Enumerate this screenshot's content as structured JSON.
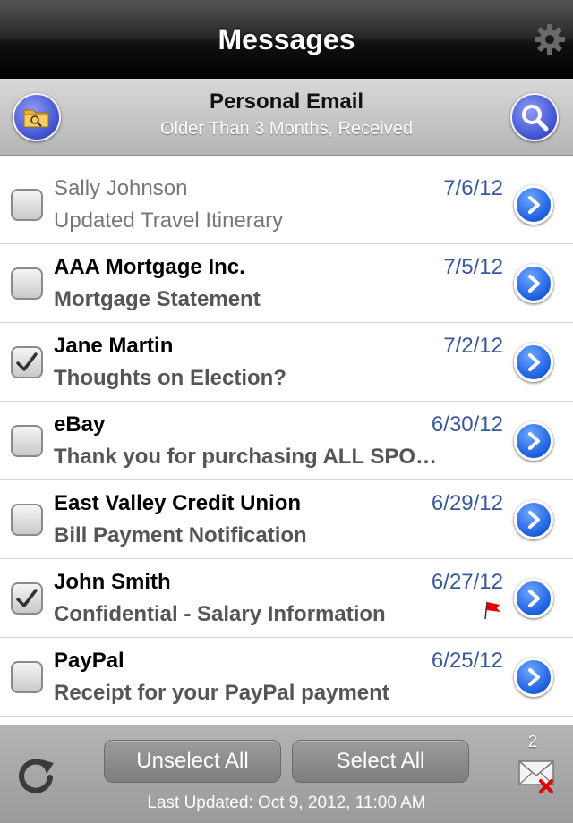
{
  "header": {
    "title": "Messages",
    "settings_icon": "gear-icon"
  },
  "subheader": {
    "title": "Personal Email",
    "caption": "Older Than 3 Months, Received",
    "folder_icon": "folder-search-icon",
    "search_icon": "search-icon"
  },
  "messages": [
    {
      "sender": "Sally Johnson",
      "subject": "Updated Travel Itinerary",
      "date": "7/6/12",
      "checked": false,
      "read": true,
      "flagged": false
    },
    {
      "sender": "AAA Mortgage Inc.",
      "subject": "Mortgage Statement",
      "date": "7/5/12",
      "checked": false,
      "read": false,
      "flagged": false
    },
    {
      "sender": "Jane Martin",
      "subject": "Thoughts on Election?",
      "date": "7/2/12",
      "checked": true,
      "read": false,
      "flagged": false
    },
    {
      "sender": "eBay",
      "subject": "Thank you for purchasing ALL SPO…",
      "date": "6/30/12",
      "checked": false,
      "read": false,
      "flagged": false
    },
    {
      "sender": "East Valley Credit Union",
      "subject": "Bill Payment Notification",
      "date": "6/29/12",
      "checked": false,
      "read": false,
      "flagged": false
    },
    {
      "sender": "John Smith",
      "subject": "Confidential - Salary Information",
      "date": "6/27/12",
      "checked": true,
      "read": false,
      "flagged": true
    },
    {
      "sender": "PayPal",
      "subject": "Receipt for your PayPal payment",
      "date": "6/25/12",
      "checked": false,
      "read": false,
      "flagged": false
    }
  ],
  "footer": {
    "unselect_label": "Unselect All",
    "select_label": "Select All",
    "last_updated": "Last Updated: Oct 9, 2012, 11:00 AM",
    "selected_count": "2",
    "refresh_icon": "refresh-icon",
    "delete_mail_icon": "delete-mail-icon"
  },
  "colors": {
    "date": "#38589a",
    "accent_blue": "#1c5fe0",
    "flag": "#e00000"
  }
}
